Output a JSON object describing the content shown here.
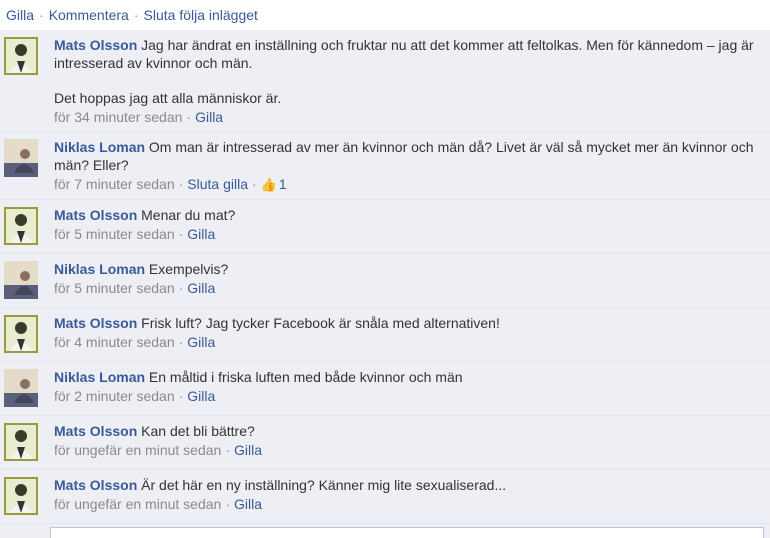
{
  "actions": {
    "like": "Gilla",
    "comment": "Kommentera",
    "unfollow": "Sluta följa inlägget",
    "separator": "·"
  },
  "comments": [
    {
      "author": "Mats Olsson",
      "text": "Jag har ändrat en inställning och fruktar nu att det kommer att feltolkas. Men för kännedom – jag är intresserad av kvinnor och män.",
      "text2": "Det hoppas jag att alla människor är.",
      "time": "för 34 minuter sedan",
      "action": "Gilla"
    },
    {
      "author": "Niklas Loman",
      "text": "Om man är intresserad av mer än kvinnor och män då? Livet är väl så mycket mer än kvinnor och män? Eller?",
      "time": "för 7 minuter sedan",
      "action": "Sluta gilla",
      "likes": "1"
    },
    {
      "author": "Mats Olsson",
      "text": "Menar du mat?",
      "time": "för 5 minuter sedan",
      "action": "Gilla"
    },
    {
      "author": "Niklas Loman",
      "text": "Exempelvis?",
      "time": "för 5 minuter sedan",
      "action": "Gilla"
    },
    {
      "author": "Mats Olsson",
      "text": "Frisk luft? Jag tycker Facebook är snåla med alternativen!",
      "time": "för 4 minuter sedan",
      "action": "Gilla"
    },
    {
      "author": "Niklas Loman",
      "text": "En måltid i friska luften med både kvinnor och män",
      "time": "för 2 minuter sedan",
      "action": "Gilla"
    },
    {
      "author": "Mats Olsson",
      "text": "Kan det bli bättre?",
      "time": "för ungefär en minut sedan",
      "action": "Gilla"
    },
    {
      "author": "Mats Olsson",
      "text": "Är det här en ny inställning? Känner mig lite sexualiserad...",
      "time": "för ungefär en minut sedan",
      "action": "Gilla"
    }
  ],
  "colors": {
    "link": "#3b5998",
    "comment_bg": "#edeff4",
    "meta_text": "#8a8a8a"
  },
  "icons": {
    "like_count": "thumbs-up-icon"
  }
}
